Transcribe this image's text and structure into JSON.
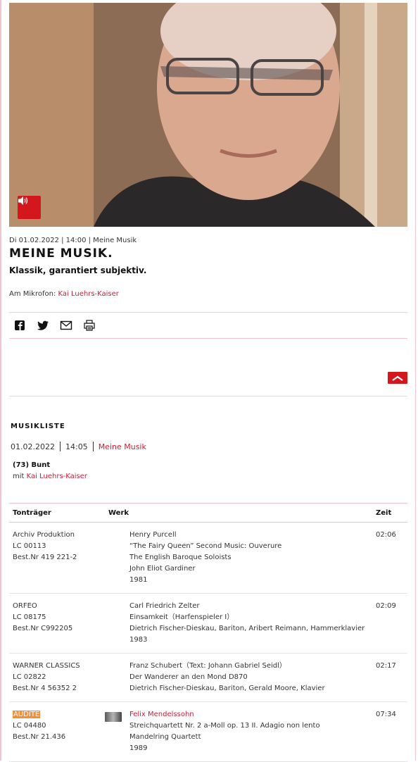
{
  "broadcast": {
    "meta": "Di 01.02.2022 | 14:00 | Meine Musik",
    "title": "MEINE MUSIK.",
    "subtitle": "Klassik, garantiert subjektiv.",
    "host_prefix": "Am Mikrofon:",
    "host_name": "Kai Luehrs-Kaiser"
  },
  "icons": {
    "audio": "speaker-icon",
    "share": [
      "facebook-icon",
      "twitter-icon",
      "mail-icon",
      "print-icon"
    ],
    "scroll_top": "chevron-up-icon"
  },
  "colors": {
    "accent": "#d4161d",
    "link": "#c8203a",
    "highlight": "#f0903a"
  },
  "musikliste": {
    "heading": "MUSIKLISTE",
    "date": "01.02.2022",
    "time": "14:05",
    "show": "Meine Musik",
    "episode": "(73) Bunt",
    "mit_prefix": "mit",
    "mit_name": "Kai Luehrs-Kaiser",
    "columns": [
      "Tonträger",
      "Werk",
      "Zeit"
    ],
    "rows": [
      {
        "label": "Archiv Produktion",
        "lc": "LC 00113",
        "best": "Best.Nr 419 221-2",
        "composer": "Henry Purcell",
        "werk": [
          "“The Fairy Queen” Second Music: Ouverure",
          "The English Baroque Soloists",
          "John Eliot Gardiner",
          "1981"
        ],
        "zeit": "02:06"
      },
      {
        "label": "ORFEO",
        "lc": "LC 08175",
        "best": "Best.Nr C992205",
        "composer": "Carl Friedrich Zelter",
        "werk": [
          "Einsamkeit（Harfenspieler I）",
          "Dietrich Fischer-Dieskau, Bariton, Aribert Reimann, Hammerklavier",
          "1983"
        ],
        "zeit": "02:09"
      },
      {
        "label": "WARNER CLASSICS",
        "lc": "LC 02822",
        "best": "Best.Nr 4 56352 2",
        "composer": "Franz Schubert（Text: Johann Gabriel Seidl）",
        "werk": [
          "Der Wanderer an den Mond D870",
          "Dietrich Fischer-Dieskau, Bariton, Gerald Moore, Klavier"
        ],
        "zeit": "02:17"
      },
      {
        "label": "AUDITE",
        "lc": "LC 04480",
        "best": "Best.Nr 21.436",
        "composer": "Felix Mendelssohn",
        "werk": [
          "Streichquartett Nr. 2 a-Moll op. 13 II. Adagio non lento",
          "Mandelring Quartett",
          "1989"
        ],
        "zeit": "07:34"
      }
    ]
  }
}
